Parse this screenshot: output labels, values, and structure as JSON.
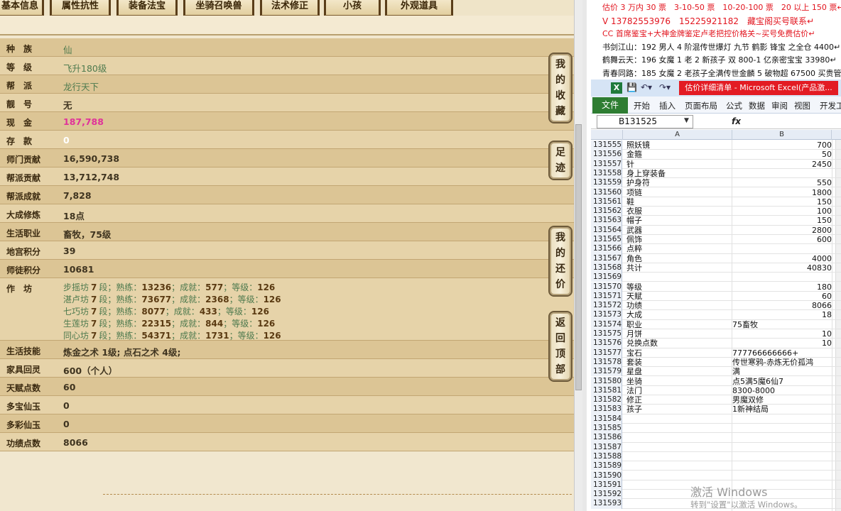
{
  "tabs": [
    {
      "label": "基本信息"
    },
    {
      "label": "属性抗性"
    },
    {
      "label": "装备法宝"
    },
    {
      "label": "坐骑召唤兽"
    },
    {
      "label": "法术修正"
    },
    {
      "label": "小孩"
    },
    {
      "label": "外观道具"
    }
  ],
  "info_rows": [
    {
      "label": "种　族",
      "value": "仙",
      "style": "green"
    },
    {
      "label": "等　级",
      "value": "飞升180级",
      "style": "green"
    },
    {
      "label": "帮　派",
      "value": "龙行天下",
      "style": "green"
    },
    {
      "label": "靓　号",
      "value": "无",
      "style": "dark"
    },
    {
      "label": "现　金",
      "value": "187,788",
      "style": "pink"
    },
    {
      "label": "存　款",
      "value": "0",
      "style": "white"
    },
    {
      "label": "师门贡献",
      "value": "16,590,738",
      "style": "dark"
    },
    {
      "label": "帮派贡献",
      "value": "13,712,748",
      "style": "dark"
    },
    {
      "label": "帮派成就",
      "value": "7,828",
      "style": "dark"
    },
    {
      "label": "大成修炼",
      "value": "18点",
      "style": "dark"
    },
    {
      "label": "生活职业",
      "value": "畜牧，75级",
      "style": "dark"
    },
    {
      "label": "地宫积分",
      "value": "39",
      "style": "dark"
    },
    {
      "label": "师徒积分",
      "value": "10681",
      "style": "dark"
    }
  ],
  "workshop": {
    "label": "作　坊",
    "lines": [
      {
        "name": "步摇坊",
        "level": "7",
        "seg": "段；熟练：",
        "skill": "13236",
        "sep1": "；成就：",
        "ach": "577",
        "sep2": "；等级：",
        "grade": "126"
      },
      {
        "name": "湛卢坊",
        "level": "7",
        "seg": "段；熟练：",
        "skill": "73677",
        "sep1": "；成就：",
        "ach": "2368",
        "sep2": "；等级：",
        "grade": "126"
      },
      {
        "name": "七巧坊",
        "level": "7",
        "seg": "段；熟练：",
        "skill": "8077",
        "sep1": "；成就：",
        "ach": "433",
        "sep2": "；等级：",
        "grade": "126"
      },
      {
        "name": "生莲坊",
        "level": "7",
        "seg": "段；熟练：",
        "skill": "22315",
        "sep1": "；成就：",
        "ach": "844",
        "sep2": "；等级：",
        "grade": "126"
      },
      {
        "name": "同心坊",
        "level": "7",
        "seg": "段；熟练：",
        "skill": "54371",
        "sep1": "；成就：",
        "ach": "1731",
        "sep2": "；等级：",
        "grade": "126"
      }
    ]
  },
  "info_rows2": [
    {
      "label": "生活技能",
      "value": "炼金之术 1级; 点石之术 4级;",
      "style": "dark"
    },
    {
      "label": "家具回灵",
      "value": "600（个人）",
      "style": "dark"
    },
    {
      "label": "天赋点数",
      "value": "60",
      "style": "dark"
    },
    {
      "label": "多宝仙玉",
      "value": "0",
      "style": "dark"
    },
    {
      "label": "多彩仙玉",
      "value": "0",
      "style": "dark"
    },
    {
      "label": "功绩点数",
      "value": "8066",
      "style": "dark"
    }
  ],
  "side_buttons": [
    {
      "chars": [
        "我",
        "的",
        "收",
        "藏"
      ]
    },
    {
      "chars": [
        "足",
        "迹"
      ]
    },
    {
      "chars": [
        "我",
        "的",
        "还",
        "价"
      ]
    },
    {
      "chars": [
        "返",
        "回",
        "顶",
        "部"
      ]
    }
  ],
  "announcement": [
    {
      "text": "估价 3 万内 30 票　3-10-50 票　10-20-100 票　20 以上 150 票↵",
      "color": "red"
    },
    {
      "text": "V 13782553976　15225921182　藏宝阁买号联系↵",
      "color": "red"
    },
    {
      "text": "CC 首席鉴宝+大神金牌鉴定卢老把控价格关~买号免费估价↵",
      "color": "red"
    },
    {
      "text": "书剑江山：192 男人 4 阶混传世爆灯 九节 鹤影 锋宝 之全仓 4400↵",
      "color": "black"
    },
    {
      "text": "鹤舞云天：196 女魔 1 老 2 新孩子 双 800-1 亿亲密宝宝 33980↵",
      "color": "black"
    },
    {
      "text": "青春同路：185 女魔 2 老孩子全满传世金麟 5 破物超 67500 买贵管退↵",
      "color": "black"
    }
  ],
  "excel": {
    "title": "估价详细清单 - Microsoft Excel(产品激...",
    "file_tab": "文件",
    "ribbon_tabs": [
      "开始",
      "插入",
      "页面布局",
      "公式",
      "数据",
      "审阅",
      "视图",
      "开发工"
    ],
    "name_box": "B131525",
    "fx": "fx",
    "columns": [
      "A",
      "B"
    ],
    "rows": [
      {
        "n": "131555",
        "a": "照妖镜",
        "b": "700"
      },
      {
        "n": "131556",
        "a": "金箍",
        "b": "50"
      },
      {
        "n": "131557",
        "a": "针",
        "b": "2450"
      },
      {
        "n": "131558",
        "a": "身上穿装备",
        "b": ""
      },
      {
        "n": "131559",
        "a": "护身符",
        "b": "550"
      },
      {
        "n": "131560",
        "a": "项链",
        "b": "1800"
      },
      {
        "n": "131561",
        "a": "鞋",
        "b": "150"
      },
      {
        "n": "131562",
        "a": "衣服",
        "b": "100"
      },
      {
        "n": "131563",
        "a": "帽子",
        "b": "150"
      },
      {
        "n": "131564",
        "a": "武器",
        "b": "2800"
      },
      {
        "n": "131565",
        "a": "佩饰",
        "b": "600"
      },
      {
        "n": "131566",
        "a": "点粹",
        "b": ""
      },
      {
        "n": "131567",
        "a": "角色",
        "b": "4000"
      },
      {
        "n": "131568",
        "a": "共计",
        "b": "40830"
      },
      {
        "n": "131569",
        "a": "",
        "b": ""
      },
      {
        "n": "131570",
        "a": "等级",
        "b": "180"
      },
      {
        "n": "131571",
        "a": "天赋",
        "b": "60"
      },
      {
        "n": "131572",
        "a": "功绩",
        "b": "8066"
      },
      {
        "n": "131573",
        "a": "大成",
        "b": "18"
      },
      {
        "n": "131574",
        "a": "职业",
        "b": "75畜牧",
        "t": true
      },
      {
        "n": "131575",
        "a": "月饼",
        "b": "10"
      },
      {
        "n": "131576",
        "a": "兑换点数",
        "b": "10"
      },
      {
        "n": "131577",
        "a": "宝石",
        "b": "777766666666+",
        "t": true
      },
      {
        "n": "131578",
        "a": "套装",
        "b": "传世寒鸦-赤炼无价孤鸿",
        "t": true
      },
      {
        "n": "131579",
        "a": "星盘",
        "b": "满",
        "t": true
      },
      {
        "n": "131580",
        "a": "坐骑",
        "b": "点5满5魔6仙7",
        "t": true
      },
      {
        "n": "131581",
        "a": "法门",
        "b": "8300-8000",
        "t": true
      },
      {
        "n": "131582",
        "a": "修正",
        "b": "男魔双修",
        "t": true
      },
      {
        "n": "131583",
        "a": "孩子",
        "b": "1新神结局",
        "t": true
      },
      {
        "n": "131584",
        "a": "",
        "b": ""
      },
      {
        "n": "131585",
        "a": "",
        "b": ""
      },
      {
        "n": "131586",
        "a": "",
        "b": ""
      },
      {
        "n": "131587",
        "a": "",
        "b": ""
      },
      {
        "n": "131588",
        "a": "",
        "b": ""
      },
      {
        "n": "131589",
        "a": "",
        "b": ""
      },
      {
        "n": "131590",
        "a": "",
        "b": ""
      },
      {
        "n": "131591",
        "a": "",
        "b": ""
      },
      {
        "n": "131592",
        "a": "",
        "b": ""
      },
      {
        "n": "131593",
        "a": "",
        "b": ""
      }
    ]
  },
  "watermark": {
    "line1": "激活 Windows",
    "line2": "转到\"设置\"以激活 Windows。"
  },
  "colors": {
    "accent_red": "#e2141e",
    "value_green": "#4e7a4e",
    "cash_pink": "#e0329a",
    "excel_green": "#2e7d32"
  }
}
